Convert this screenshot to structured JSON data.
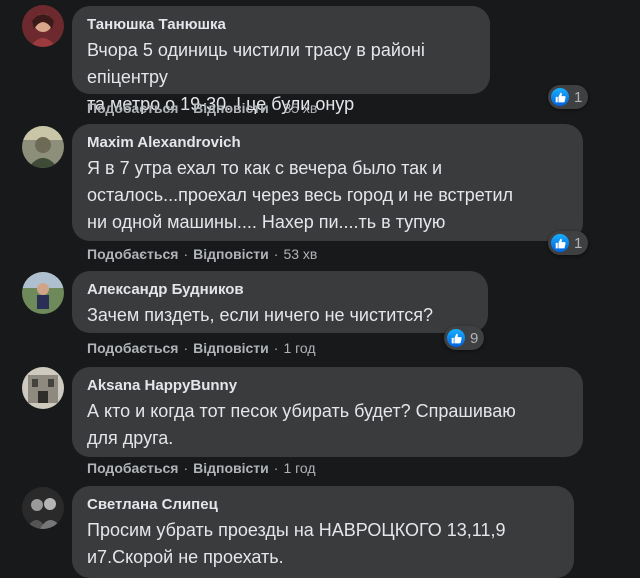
{
  "actions": {
    "like_label": "Подобається",
    "reply_label": "Відповісти",
    "separator": "·"
  },
  "comments": [
    {
      "author": "Танюшка Танюшка",
      "lines": [
        "Вчора 5 одиниць чистили трасу в районі епіцентру",
        "та метро о 19-30. І це були онур"
      ],
      "time": "35 хв",
      "reactions": "1"
    },
    {
      "author": "Maxim Alexandrovich",
      "lines": [
        "Я в 7 утра ехал то как с вечера было так и",
        "осталось...проехал через весь город и не встретил",
        "ни одной машины.... Нахер пи....ть в тупую"
      ],
      "time": "53 хв",
      "reactions": "1"
    },
    {
      "author": "Александр Будников",
      "lines": [
        "Зачем пиздеть, если ничего не чистится?"
      ],
      "time": "1 год",
      "reactions": "9"
    },
    {
      "author": "Aksana HappyBunny",
      "lines": [
        "А кто и когда тот песок убирать будет? Спрашиваю",
        "для друга."
      ],
      "time": "1 год",
      "reactions": ""
    },
    {
      "author": "Светлана Слипец",
      "lines": [
        "Просим убрать проезды на НАВРОЦКОГО 13,11,9",
        "и7.Скорой не проехать."
      ],
      "time": "",
      "reactions": ""
    }
  ]
}
